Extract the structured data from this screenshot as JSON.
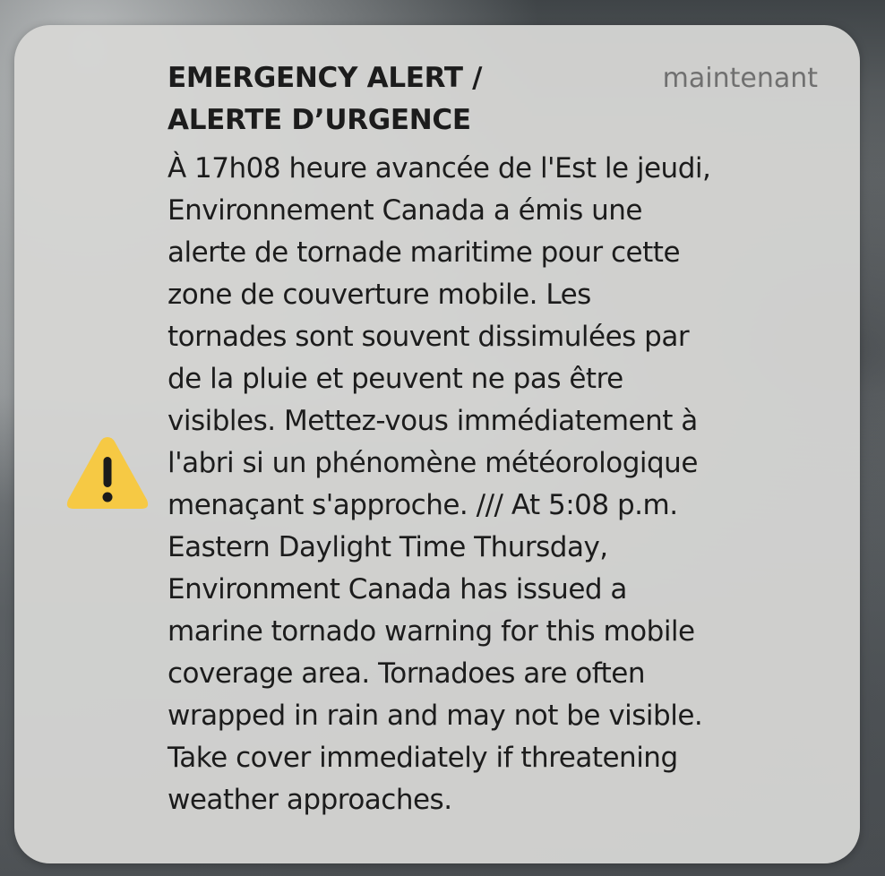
{
  "notification": {
    "title_lines": [
      "EMERGENCY ALERT /",
      "ALERTE D’URGENCE"
    ],
    "timestamp": "maintenant",
    "icon": "warning-triangle-icon",
    "icon_color": "#f6c944",
    "body_lines": [
      "À 17h08 heure avancée de l'Est le jeudi,",
      "Environnement Canada a émis une",
      "alerte de tornade maritime pour cette",
      "zone de couverture mobile. Les",
      "tornades sont souvent dissimulées par",
      "de la pluie et peuvent ne pas être",
      "visibles. Mettez-vous immédiatement à",
      "l'abri si un phénomène météorologique",
      "menaçant s'approche. /// At 5:08 p.m.",
      "Eastern Daylight Time Thursday,",
      "Environment Canada has issued a",
      "marine tornado warning for this mobile",
      "coverage area. Tornadoes are often",
      "wrapped in rain and may not be visible.",
      "Take cover immediately if threatening",
      "weather approaches."
    ]
  }
}
